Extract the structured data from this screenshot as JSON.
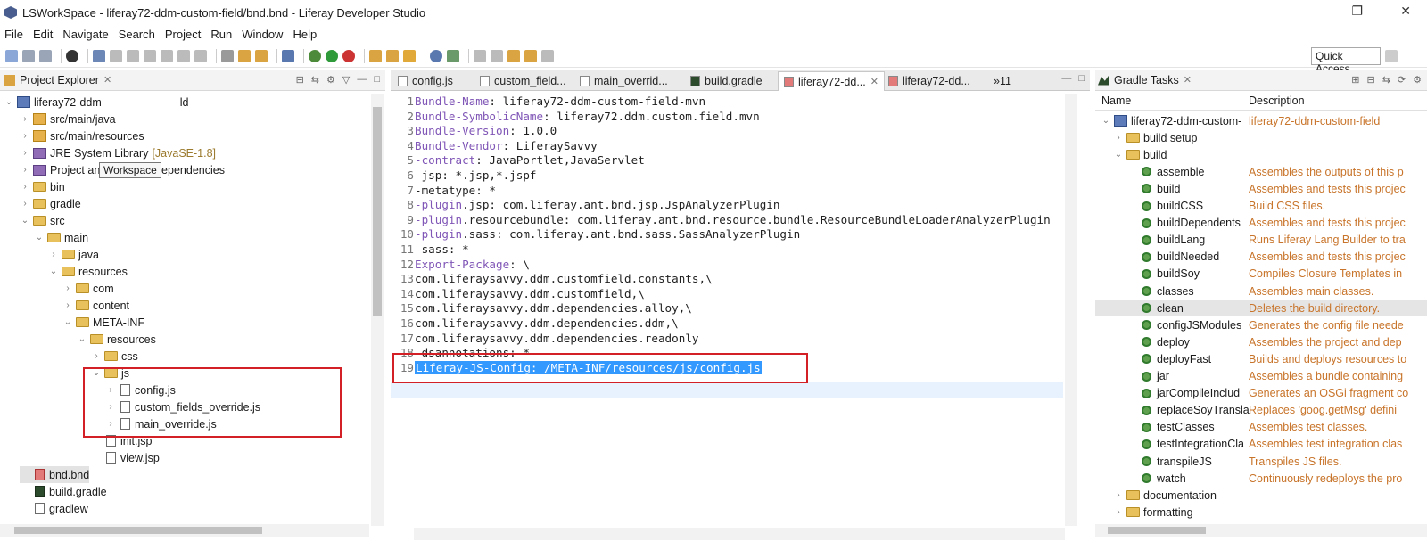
{
  "window": {
    "title": "LSWorkSpace - liferay72-ddm-custom-field/bnd.bnd - Liferay Developer Studio"
  },
  "menu": [
    "File",
    "Edit",
    "Navigate",
    "Search",
    "Project",
    "Run",
    "Window",
    "Help"
  ],
  "toolbar": {
    "quick_access": "Quick Access"
  },
  "project_explorer": {
    "title": "Project Explorer",
    "tooltip": "Workspace",
    "root_label": "liferay72-ddm",
    "root_suffix": "ld",
    "items": [
      {
        "label": "src/main/java",
        "icon": "package-folder-icon"
      },
      {
        "label": "src/main/resources",
        "icon": "package-folder-icon"
      },
      {
        "label": "JRE System Library",
        "hint": "[JavaSE-1.8]",
        "icon": "library-icon"
      },
      {
        "label": "Project and External Dependencies",
        "icon": "library-icon"
      },
      {
        "label": "bin",
        "icon": "folder-icon"
      },
      {
        "label": "gradle",
        "icon": "folder-icon"
      },
      {
        "label": "src",
        "icon": "folder-icon"
      },
      {
        "label": "main",
        "icon": "folder-icon"
      },
      {
        "label": "java",
        "icon": "folder-icon"
      },
      {
        "label": "resources",
        "icon": "folder-icon"
      },
      {
        "label": "com",
        "icon": "folder-icon"
      },
      {
        "label": "content",
        "icon": "folder-icon"
      },
      {
        "label": "META-INF",
        "icon": "folder-icon"
      },
      {
        "label": "resources",
        "icon": "folder-icon"
      },
      {
        "label": "css",
        "icon": "folder-icon"
      },
      {
        "label": "js",
        "icon": "folder-icon"
      },
      {
        "label": "config.js",
        "icon": "js-file-icon"
      },
      {
        "label": "custom_fields_override.js",
        "icon": "js-file-icon"
      },
      {
        "label": "main_override.js",
        "icon": "js-file-icon"
      },
      {
        "label": "init.jsp",
        "icon": "jsp-file-icon"
      },
      {
        "label": "view.jsp",
        "icon": "jsp-file-icon"
      },
      {
        "label": "bnd.bnd",
        "icon": "bnd-file-icon"
      },
      {
        "label": "build.gradle",
        "icon": "gradle-file-icon"
      },
      {
        "label": "gradlew",
        "icon": "file-icon"
      }
    ]
  },
  "editor": {
    "tabs": [
      "config.js",
      "custom_field...",
      "main_overrid...",
      "build.gradle",
      "liferay72-dd...",
      "liferay72-dd...",
      "»11"
    ],
    "lines": [
      {
        "n": "1",
        "key": "Bundle-Name",
        "rest": ": liferay72-ddm-custom-field-mvn"
      },
      {
        "n": "2",
        "key": "Bundle-SymbolicName",
        "rest": ": liferay72.ddm.custom.field.mvn"
      },
      {
        "n": "3",
        "key": "Bundle-Version",
        "rest": ": 1.0.0"
      },
      {
        "n": "4",
        "key": "Bundle-Vendor",
        "rest": ": LiferaySavvy"
      },
      {
        "n": "5",
        "key": "-contract",
        "rest": ": JavaPortlet,JavaServlet"
      },
      {
        "n": "6",
        "key": "",
        "rest": "-jsp: *.jsp,*.jspf"
      },
      {
        "n": "7",
        "key": "",
        "rest": "-metatype: *"
      },
      {
        "n": "8",
        "key": "-plugin",
        "rest": ".jsp: com.liferay.ant.bnd.jsp.JspAnalyzerPlugin"
      },
      {
        "n": "9",
        "key": "-plugin",
        "rest": ".resourcebundle: com.liferay.ant.bnd.resource.bundle.ResourceBundleLoaderAnalyzerPlugin"
      },
      {
        "n": "10",
        "key": "-plugin",
        "rest": ".sass: com.liferay.ant.bnd.sass.SassAnalyzerPlugin"
      },
      {
        "n": "11",
        "key": "",
        "rest": "-sass: *"
      },
      {
        "n": "12",
        "key": "Export-Package",
        "rest": ": \\"
      },
      {
        "n": "13",
        "key": "",
        "rest": "com.liferaysavvy.ddm.customfield.constants,\\"
      },
      {
        "n": "14",
        "key": "",
        "rest": "com.liferaysavvy.ddm.customfield,\\"
      },
      {
        "n": "15",
        "key": "",
        "rest": "com.liferaysavvy.ddm.dependencies.alloy,\\"
      },
      {
        "n": "16",
        "key": "",
        "rest": "com.liferaysavvy.ddm.dependencies.ddm,\\"
      },
      {
        "n": "17",
        "key": "",
        "rest": "com.liferaysavvy.ddm.dependencies.readonly"
      },
      {
        "n": "18",
        "key": "",
        "rest": "-dsannotations: *"
      },
      {
        "n": "19",
        "key": "",
        "rest": "Liferay-JS-Config: /META-INF/resources/js/config.js"
      }
    ]
  },
  "gradle": {
    "title": "Gradle Tasks",
    "col_name": "Name",
    "col_desc": "Description",
    "root": {
      "name": "liferay72-ddm-custom-",
      "desc": "liferay72-ddm-custom-field"
    },
    "groups_before": [
      {
        "name": "build setup"
      }
    ],
    "build_group": "build",
    "tasks": [
      {
        "name": "assemble",
        "desc": "Assembles the outputs of this p"
      },
      {
        "name": "build",
        "desc": "Assembles and tests this projec"
      },
      {
        "name": "buildCSS",
        "desc": "Build CSS files."
      },
      {
        "name": "buildDependents",
        "desc": "Assembles and tests this projec"
      },
      {
        "name": "buildLang",
        "desc": "Runs Liferay Lang Builder to tra"
      },
      {
        "name": "buildNeeded",
        "desc": "Assembles and tests this projec"
      },
      {
        "name": "buildSoy",
        "desc": "Compiles Closure Templates in"
      },
      {
        "name": "classes",
        "desc": "Assembles main classes."
      },
      {
        "name": "clean",
        "desc": "Deletes the build directory."
      },
      {
        "name": "configJSModules",
        "desc": "Generates the config file neede"
      },
      {
        "name": "deploy",
        "desc": "Assembles the project and dep"
      },
      {
        "name": "deployFast",
        "desc": "Builds and deploys resources to"
      },
      {
        "name": "jar",
        "desc": "Assembles a bundle containing"
      },
      {
        "name": "jarCompileInclud",
        "desc": "Generates an OSGi fragment co"
      },
      {
        "name": "replaceSoyTransla",
        "desc": "Replaces 'goog.getMsg' defini"
      },
      {
        "name": "testClasses",
        "desc": "Assembles test classes."
      },
      {
        "name": "testIntegrationCla",
        "desc": "Assembles test integration clas"
      },
      {
        "name": "transpileJS",
        "desc": "Transpiles JS files."
      },
      {
        "name": "watch",
        "desc": "Continuously redeploys the pro"
      }
    ],
    "groups_after": [
      {
        "name": "documentation"
      },
      {
        "name": "formatting"
      }
    ]
  },
  "colors": {
    "highlight_box": "#d32027",
    "selection": "#3399ff",
    "key_purple": "#7f55b6",
    "desc_orange": "#c8742a"
  }
}
